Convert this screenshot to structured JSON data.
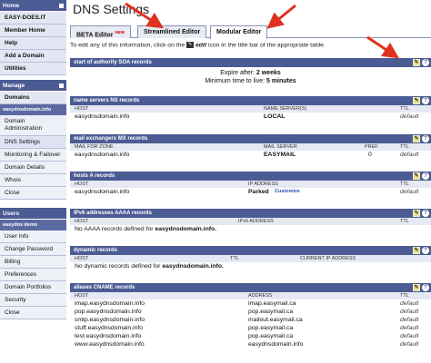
{
  "sidebar": {
    "home_header": "Home",
    "user_label": "EASY-DOES.IT",
    "top_items": [
      {
        "label": "Member Home"
      },
      {
        "label": "Help"
      },
      {
        "label": "Add a Domain"
      },
      {
        "label": "Utilities"
      }
    ],
    "manage_header": "Manage",
    "domains_label": "Domains",
    "domain_sub": "easydnsdomain.info",
    "domain_items": [
      {
        "label": "Domain Administration"
      },
      {
        "label": "DNS Settings"
      },
      {
        "label": "Monitoring & Failover"
      },
      {
        "label": "Domain Details"
      },
      {
        "label": "Whois"
      },
      {
        "label": "Close"
      }
    ],
    "users_header": "Users",
    "user_sub": "easydns demo",
    "user_items": [
      {
        "label": "User Info"
      },
      {
        "label": "Change Password"
      },
      {
        "label": "Billing"
      },
      {
        "label": "Preferences"
      },
      {
        "label": "Domain Portfolios"
      },
      {
        "label": "Security"
      },
      {
        "label": "Close"
      }
    ]
  },
  "main": {
    "title": "DNS Settings",
    "tabs": [
      {
        "label": "BETA Editor",
        "badge": "NEW"
      },
      {
        "label": "Streamlined Editor"
      },
      {
        "label": "Modular Editor"
      }
    ],
    "intro_prefix": "To edit any of this information, click on the",
    "intro_edit": "edit",
    "intro_suffix": "icon in the title bar of the appropriate table.",
    "intro_pencil": "✎"
  },
  "soa": {
    "title": "start of authority SOA records",
    "expire_label": "Expire after:",
    "expire_value": "2 weeks",
    "min_ttl_label": "Minimum time to live:",
    "min_ttl_value": "5 minutes"
  },
  "ns": {
    "title": "name servers NS records",
    "cols": [
      "HOST",
      "NAME SERVER(S)",
      "TTL"
    ],
    "rows": [
      {
        "host": "easydnsdomain.info",
        "server": "LOCAL",
        "ttl": "default"
      }
    ]
  },
  "mx": {
    "title": "mail exchangers MX records",
    "cols": [
      "MAIL FOR ZONE",
      "MAIL SERVER",
      "PREF",
      "TTL"
    ],
    "rows": [
      {
        "zone": "easydnsdomain.info",
        "server": "EASYMAIL",
        "pref": "0",
        "ttl": "default"
      }
    ]
  },
  "a": {
    "title": "hosts A records",
    "cols": [
      "HOST",
      "IP ADDRESS",
      "TTL"
    ],
    "rows": [
      {
        "host": "easydnsdomain.info",
        "ip": "Parked",
        "link": "Customize",
        "ttl": "default"
      }
    ]
  },
  "aaaa": {
    "title": "IPv6 addresses AAAA records",
    "cols": [
      "HOST",
      "IPv6 ADDRESS",
      "TTL"
    ],
    "empty_prefix": "No AAAA records defined for",
    "empty_domain": "easydnsdomain.info."
  },
  "dyn": {
    "title": "dynamic records",
    "cols": [
      "HOST",
      "TTL",
      "CURRENT IP ADDRESS"
    ],
    "empty_prefix": "No dynamic records defined for",
    "empty_domain": "easydnsdomain.info."
  },
  "cname": {
    "title": "aliases CNAME records",
    "cols": [
      "HOST",
      "ADDRESS",
      "TTL"
    ],
    "rows": [
      {
        "host": "imap.easydnsdomain.info",
        "addr": "imap.easymail.ca",
        "ttl": "default"
      },
      {
        "host": "pop.easydnsdomain.info",
        "addr": "pop.easymail.ca",
        "ttl": "default"
      },
      {
        "host": "smtp.easydnsdomain.info",
        "addr": "mailout.easymail.ca",
        "ttl": "default"
      },
      {
        "host": "stuff.easydnsdomain.info",
        "addr": "pop.easymail.ca",
        "ttl": "default"
      },
      {
        "host": "test.easydnsdomain.info",
        "addr": "pop.easymail.ca",
        "ttl": "default"
      },
      {
        "host": "www.easydnsdomain.info",
        "addr": "easydnsdomain.info",
        "ttl": "default"
      }
    ]
  },
  "icons": {
    "edit": "pencil-icon",
    "help": "help-icon"
  },
  "colors": {
    "header": "#4b5b93",
    "arrow": "#e0321e",
    "link": "#2a4fb0"
  }
}
